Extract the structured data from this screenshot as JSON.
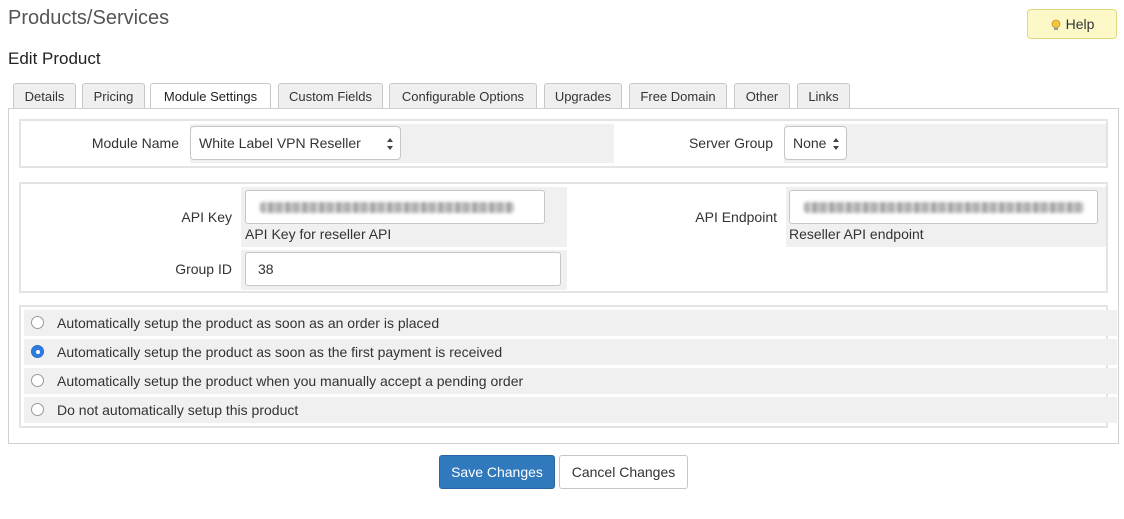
{
  "header": {
    "title": "Products/Services",
    "subtitle": "Edit Product",
    "help_label": "Help"
  },
  "tabs": [
    {
      "label": "Details",
      "active": false
    },
    {
      "label": "Pricing",
      "active": false
    },
    {
      "label": "Module Settings",
      "active": true
    },
    {
      "label": "Custom Fields",
      "active": false
    },
    {
      "label": "Configurable Options",
      "active": false
    },
    {
      "label": "Upgrades",
      "active": false
    },
    {
      "label": "Free Domain",
      "active": false
    },
    {
      "label": "Other",
      "active": false
    },
    {
      "label": "Links",
      "active": false
    }
  ],
  "module": {
    "module_name_label": "Module Name",
    "module_name_value": "White Label VPN Reseller",
    "server_group_label": "Server Group",
    "server_group_value": "None"
  },
  "config": {
    "api_key_label": "API Key",
    "api_key_help": "API Key for reseller API",
    "api_endpoint_label": "API Endpoint",
    "api_endpoint_help": "Reseller API endpoint",
    "group_id_label": "Group ID",
    "group_id_value": "38"
  },
  "setup_options": [
    {
      "label": "Automatically setup the product as soon as an order is placed",
      "checked": false
    },
    {
      "label": "Automatically setup the product as soon as the first payment is received",
      "checked": true
    },
    {
      "label": "Automatically setup the product when you manually accept a pending order",
      "checked": false
    },
    {
      "label": "Do not automatically setup this product",
      "checked": false
    }
  ],
  "actions": {
    "save_label": "Save Changes",
    "cancel_label": "Cancel Changes"
  },
  "colors": {
    "primary": "#3079bd",
    "radio_selected": "#2f7de1",
    "help_bg": "#fcf8c8"
  },
  "icons": {
    "help": "lightbulb-icon",
    "select": "select-arrows-icon"
  }
}
